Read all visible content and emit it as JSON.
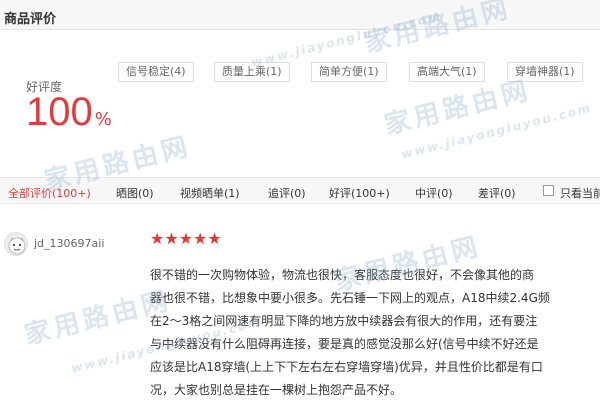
{
  "section": {
    "title": "商品评价"
  },
  "rating": {
    "label": "好评度",
    "value": "100",
    "unit": "%"
  },
  "tags": [
    "信号稳定(4)",
    "质量上乘(1)",
    "简单方便(1)",
    "高端大气(1)",
    "穿墙神器(1)"
  ],
  "filters": {
    "tabs": [
      "全部评价(100+)",
      "晒图(0)",
      "视频晒单(1)",
      "追评(0)",
      "好评(100+)",
      "中评(0)",
      "差评(0)"
    ],
    "active_index": 0,
    "checkbox_label": "只看当前"
  },
  "review": {
    "username": "jd_130697aii",
    "stars": "★★★★★",
    "rating": 5,
    "lines": [
      "很不错的一次购物体验，物流也很快，客服态度也很好，不会像其他的商",
      "器也很不错，比想象中要小很多。先石锤一下网上的观点，A18中续2.4G频",
      "在2～3格之间网速有明显下降的地方放中续器会有很大的作用，还有要注",
      "与中续器没有什么阻碍再连接，要是真的感觉没那么好(信号中续不好还是",
      "应该是比A18穿墙(上上下下左右左右穿墙穿墙)优异，并且性价比都是有口",
      "况，大家也别总是挂在一棵树上抱怨产品不好。"
    ]
  },
  "watermark": {
    "text": "家用路由网",
    "url": "www.jiayongluyou.com"
  },
  "colors": {
    "accent": "#e4393c",
    "watermark": "#96b4d2"
  }
}
